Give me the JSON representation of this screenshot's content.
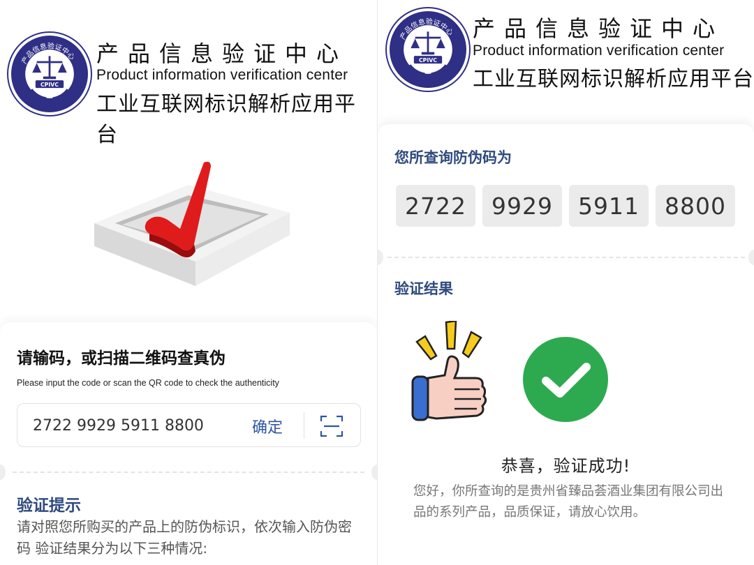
{
  "header": {
    "org_cn": "产品信息验证中心",
    "org_en": "Product information verification center",
    "platform": "工业互联网标识解析应用平台",
    "logo_text_top": "产品信息验证中心",
    "logo_badge": "CPIVC"
  },
  "left": {
    "prompt_title": "请输码，或扫描二维码查真伪",
    "prompt_sub": "Please input the code or scan the QR code to check the authenticity",
    "code_value": "2722 9929 5911 8800",
    "confirm_label": "确定",
    "tips_title": "验证提示",
    "tips_body": "请对照您所购买的产品上的防伪标识，依次输入防伪密码 验证结果分为以下三种情况:"
  },
  "right": {
    "query_label": "您所查询防伪码为",
    "code_groups": [
      "2722",
      "9929",
      "5911",
      "8800"
    ],
    "result_label": "验证结果",
    "success_title": "恭喜，验证成功!",
    "success_desc": "您好，你所查询的是贵州省臻品荟酒业集团有限公司出品的系列产品，品质保证，请放心饮用。"
  },
  "colors": {
    "brand_navy": "#2f2f86",
    "label_blue": "#2f4a7e",
    "link_blue": "#2f55a4",
    "success_green": "#2daa4f",
    "check_red": "#e01b1b"
  },
  "icons": [
    "cpivc-logo",
    "red-checkmark-icon",
    "scan-qr-icon",
    "thumbs-up-icon",
    "green-check-icon"
  ]
}
